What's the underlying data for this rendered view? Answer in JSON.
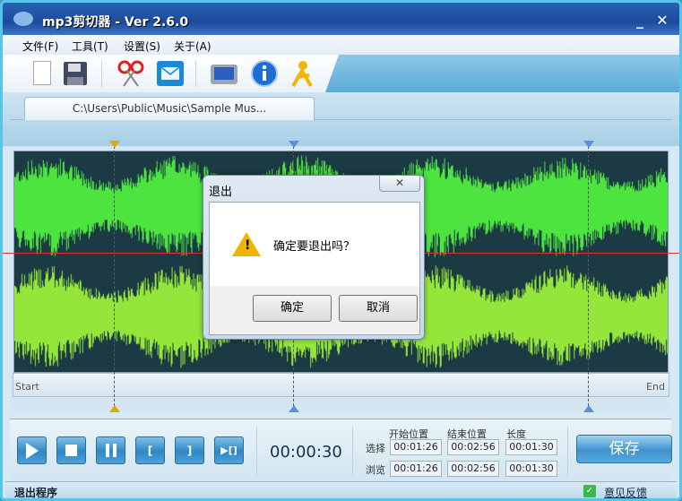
{
  "window": {
    "title": "mp3剪切器 - Ver 2.6.0",
    "minimize": "_",
    "close": "✕"
  },
  "menu": [
    {
      "label": "文件(F)"
    },
    {
      "label": "工具(T)"
    },
    {
      "label": "设置(S)"
    },
    {
      "label": "关于(A)"
    }
  ],
  "toolbar": {
    "icons": [
      "new-file-icon",
      "save-icon",
      "scissors-icon",
      "mail-icon",
      "screen-icon",
      "info-icon",
      "user-icon"
    ]
  },
  "tab": {
    "label": "C:\\Users\\Public\\Music\\Sample Mus..."
  },
  "waveform": {
    "start_label": "Start",
    "end_label": "End",
    "markers": [
      {
        "fraction": 0.153,
        "color": "#e8a500"
      },
      {
        "fraction": 0.427,
        "color": "#5b8fd8"
      },
      {
        "fraction": 0.877,
        "color": "#5b8fd8"
      }
    ],
    "top_color": "#4de43f",
    "bottom_color": "#94e63a"
  },
  "controls": {
    "current_time": "00:00:30",
    "headers": [
      "开始位置",
      "结束位置",
      "长度"
    ],
    "rows": [
      {
        "label": "选择",
        "values": [
          "00:01:26",
          "00:02:56",
          "00:01:30"
        ]
      },
      {
        "label": "浏览",
        "values": [
          "00:01:26",
          "00:02:56",
          "00:01:30"
        ]
      }
    ],
    "save_label": "保存"
  },
  "status": {
    "text": "退出程序",
    "feedback": "意见反馈"
  },
  "dialog": {
    "title": "退出",
    "message": "确定要退出吗？",
    "ok": "确定",
    "cancel": "取消",
    "close": "✕"
  }
}
